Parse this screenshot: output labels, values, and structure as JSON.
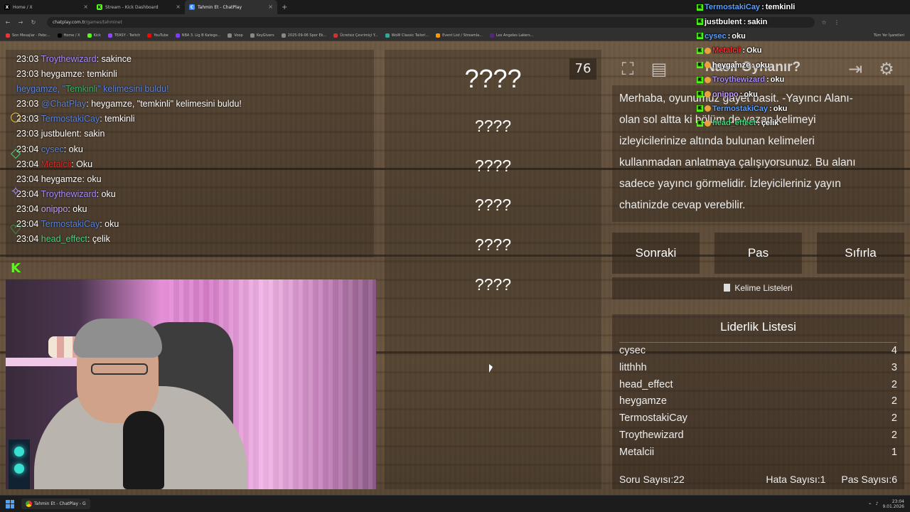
{
  "browser": {
    "tabs": [
      {
        "label": "Home / X",
        "icon": "x-logo-icon",
        "active": false
      },
      {
        "label": "Stream - Kick Dashboard",
        "icon": "kick-logo-icon",
        "active": false
      },
      {
        "label": "Tahmin Et - ChatPlay",
        "icon": "chatplay-icon",
        "active": true
      }
    ],
    "url_host": "chatplay.com.tr",
    "url_path": "/games/tahminet",
    "bookmarks": [
      "Son Mesajlar - Pebc...",
      "Home / X",
      "Kick",
      "TEASY - Twitch",
      "YouTube",
      "NBA 3. Lig B Katego...",
      "Voop",
      "KeyGivers",
      "2025-09-06 Spor Ek...",
      "Ücretsiz Çevrimiçi Y...",
      "WoW Classic Tailori...",
      "Event List / Streamla...",
      "Los Angeles Lakers..."
    ],
    "bookmarks_right": "Tüm Yer İşaretleri"
  },
  "chat": {
    "lines": [
      {
        "time": "23:03",
        "user": "Troythewizard",
        "color": "#a78bff",
        "msg": "sakince"
      },
      {
        "time": "23:03",
        "user": "heygamze",
        "color": "#ffffff",
        "msg": "temkinli"
      },
      {
        "system": true,
        "pre": "heygamze, \"",
        "word": "Temkinli",
        "post": "\" kelimesini buldu!"
      },
      {
        "time": "23:03",
        "user": "@ChatPlay",
        "color": "#5b84d8",
        "msg": "heygamze, \"temkinli\" kelimesini buldu!"
      },
      {
        "time": "23:03",
        "user": "TermostakiCay",
        "color": "#5b84d8",
        "msg": "temkinli"
      },
      {
        "time": "23:03",
        "user": "justbulent",
        "color": "#ffffff",
        "msg": "sakin"
      },
      {
        "time": "23:04",
        "user": "cysec",
        "color": "#5b84d8",
        "msg": "oku"
      },
      {
        "time": "23:04",
        "user": "Metalcii",
        "color": "#d82b2b",
        "msg": "Oku"
      },
      {
        "time": "23:04",
        "user": "heygamze",
        "color": "#ffffff",
        "msg": "oku"
      },
      {
        "time": "23:04",
        "user": "Troythewizard",
        "color": "#a78bff",
        "msg": "oku"
      },
      {
        "time": "23:04",
        "user": "onippo",
        "color": "#c49cff",
        "msg": "oku"
      },
      {
        "time": "23:04",
        "user": "TermostakiCay",
        "color": "#5b84d8",
        "msg": "oku"
      },
      {
        "time": "23:04",
        "user": "head_effect",
        "color": "#3fd87a",
        "msg": "çelik"
      }
    ]
  },
  "game": {
    "timer": "76",
    "words": [
      "????",
      "????",
      "????",
      "????",
      "????",
      "????"
    ],
    "how_to_title": "Nasıl Oynanır?",
    "info_lines": [
      "Merhaba, oyunumuz gayet basit. -Yayıncı Alanı-",
      "olan sol altta ki bölüm de yazan kelimeyi",
      "izleyicilerinize altında bulunan kelimeleri",
      "kullanmadan anlatmaya çalışıyorsunuz. Bu alanı",
      "sadece yayıncı görmelidir. İzleyicileriniz yayın",
      "chatinizde cevap verebilir."
    ],
    "buttons": {
      "next": "Sonraki",
      "pass": "Pas",
      "reset": "Sıfırla"
    },
    "word_lists": "Kelime Listeleri"
  },
  "leaderboard": {
    "title": "Liderlik Listesi",
    "rows": [
      {
        "name": "cysec",
        "score": "4"
      },
      {
        "name": "litthhh",
        "score": "3"
      },
      {
        "name": "head_effect",
        "score": "2"
      },
      {
        "name": "heygamze",
        "score": "2"
      },
      {
        "name": "TermostakiCay",
        "score": "2"
      },
      {
        "name": "Troythewizard",
        "score": "2"
      },
      {
        "name": "Metalcii",
        "score": "1"
      }
    ],
    "question_count": "Soru Sayısı:22",
    "error_count": "Hata Sayısı:1",
    "pass_count": "Pas Sayısı:6"
  },
  "overlay_chat": [
    {
      "user": "TermostakiCay",
      "color": "#5aa0ff",
      "msg": "temkinli"
    },
    {
      "user": "justbulent",
      "color": "#ffffff",
      "msg": "sakin"
    },
    {
      "user": "cysec",
      "color": "#5aa0ff",
      "msg": "oku"
    },
    {
      "user": "Metalcii",
      "color": "#ff3030",
      "msg": "Oku"
    },
    {
      "user": "heygamze",
      "color": "#ffffff",
      "msg": "oku"
    },
    {
      "user": "Troythewizard",
      "color": "#a78bff",
      "msg": "oku"
    },
    {
      "user": "onippo",
      "color": "#c49cff",
      "msg": "oku"
    },
    {
      "user": "TermostakiCay",
      "color": "#5aa0ff",
      "msg": "oku"
    },
    {
      "user": "head_effect",
      "color": "#3fd87a",
      "msg": "çelik"
    }
  ],
  "taskbar": {
    "app": "Tahmin Et - ChatPlay - G",
    "time": "23:04",
    "date": "9.01.2026"
  }
}
